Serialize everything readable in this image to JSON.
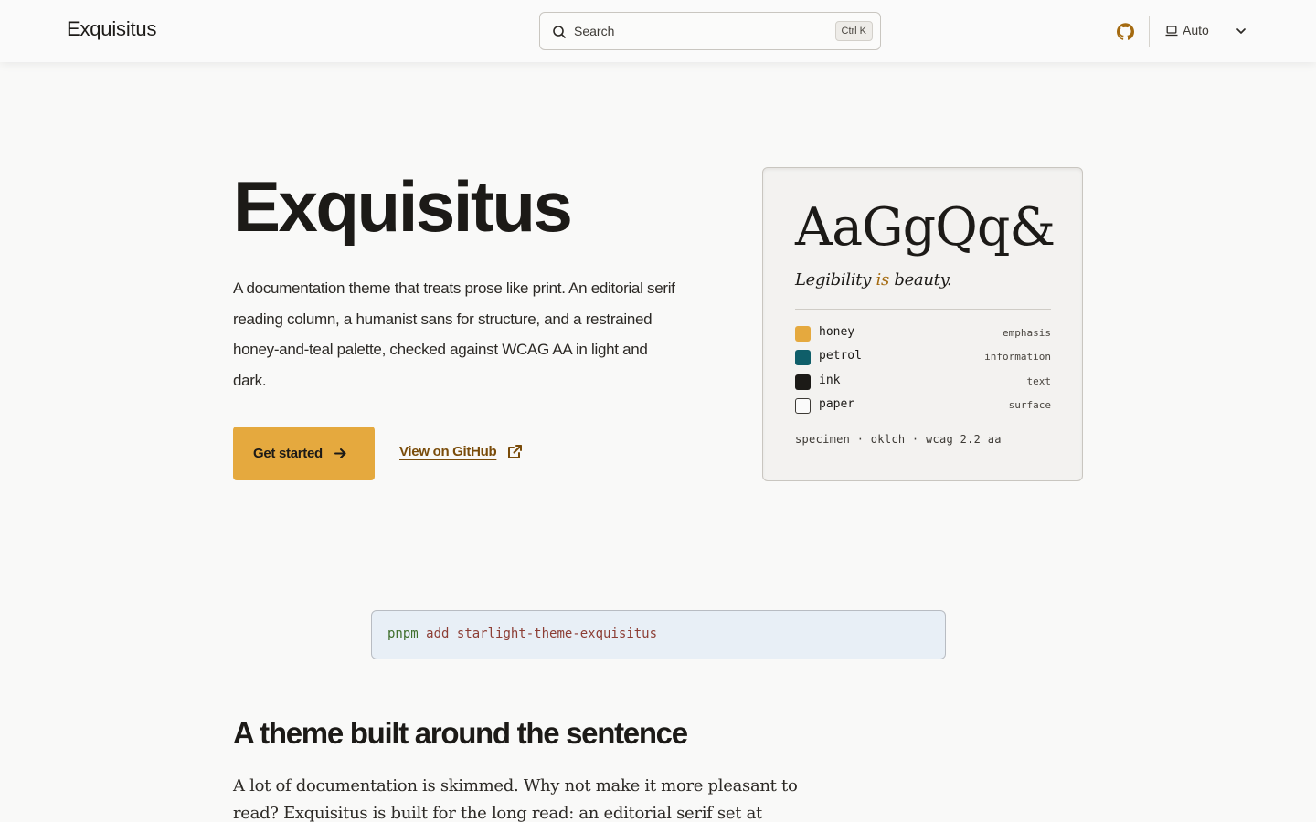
{
  "header": {
    "site_title": "Exquisitus",
    "search_label": "Search",
    "search_shortcut": "Ctrl K",
    "theme_label": "Auto"
  },
  "hero": {
    "title": "Exquisitus",
    "tagline": "A documentation theme that treats prose like print. An editorial serif reading column, a humanist sans for structure, and a restrained honey-and-teal palette, checked against WCAG AA in light and dark.",
    "primary_action": "Get started",
    "secondary_action": "View on GitHub"
  },
  "specimen": {
    "glyphs": "AaGgQq&",
    "slogan_start": "Legibility ",
    "slogan_accent": "is",
    "slogan_end": " beauty.",
    "swatches": [
      {
        "name": "honey",
        "role": "emphasis",
        "color": "#e5a93e"
      },
      {
        "name": "petrol",
        "role": "information",
        "color": "#0f5e69"
      },
      {
        "name": "ink",
        "role": "text",
        "color": "#1c1a17"
      },
      {
        "name": "paper",
        "role": "surface",
        "color": "#fafafa"
      }
    ],
    "footer": "specimen · oklch · wcag 2.2 aa"
  },
  "install": {
    "cmd": "pnpm",
    "sub": "add",
    "pkg": "starlight-theme-exquisitus"
  },
  "section": {
    "title": "A theme built around the sentence",
    "body": "A lot of documentation is skimmed. Why not make it more pleasant to read? Exquisitus is built for the long read: an editorial serif set at book"
  },
  "colors": {
    "accent": "#e5a93e",
    "link": "#7a4c0a",
    "github_icon": "#a46a10"
  }
}
